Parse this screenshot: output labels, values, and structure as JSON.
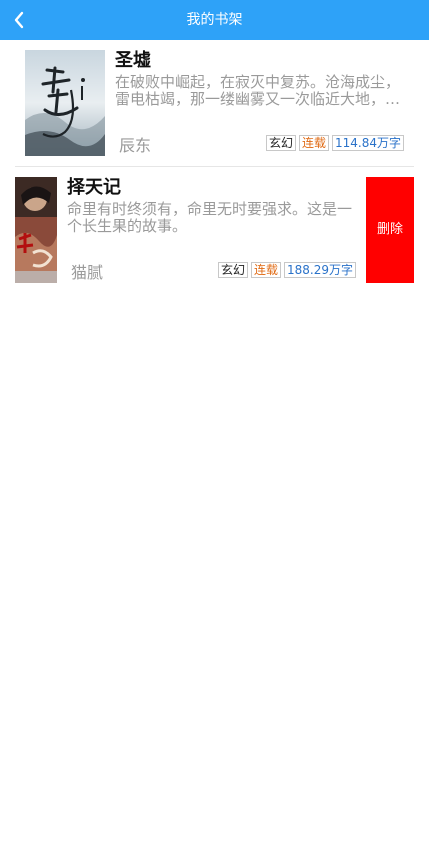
{
  "header": {
    "title": "我的书架",
    "back_icon": "chevron-left-icon",
    "background": "#2ea2f8"
  },
  "books": [
    {
      "title": "圣墟",
      "description": "在破败中崛起，在寂灭中复苏。沧海成尘，雷电枯竭，那一缕幽雾又一次临近大地，世间的枷锁被打开了，一个全新的世界就此揭开神秘的一角……",
      "author": "辰东",
      "genre": "玄幻",
      "status": "连载",
      "words": "114.84万字"
    },
    {
      "title": "择天记",
      "description": "命里有时终须有，命里无时要强求。这是一个长生果的故事。",
      "author": "猫腻",
      "genre": "玄幻",
      "status": "连载",
      "words": "188.29万字"
    }
  ],
  "actions": {
    "delete_label": "删除",
    "delete_color": "#ff0000"
  }
}
